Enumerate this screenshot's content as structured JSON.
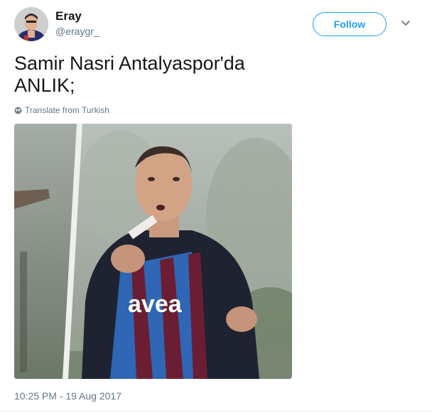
{
  "tweet": {
    "display_name": "Eray",
    "handle": "@eraygr_",
    "follow_label": "Follow",
    "text": "Samir Nasri Antalyaspor'da\nANLIK;",
    "translate_label": "Translate from Turkish",
    "timestamp": "10:25 PM - 19 Aug 2017",
    "media_jersey_text": "avea"
  },
  "icons": {
    "menu": "chevron-down-icon",
    "translate": "globe-icon"
  },
  "colors": {
    "accent": "#1da1f2",
    "secondary_text": "#657786",
    "primary_text": "#14171a",
    "jersey_claret": "#6b1e33",
    "jersey_blue": "#2f66b5"
  }
}
